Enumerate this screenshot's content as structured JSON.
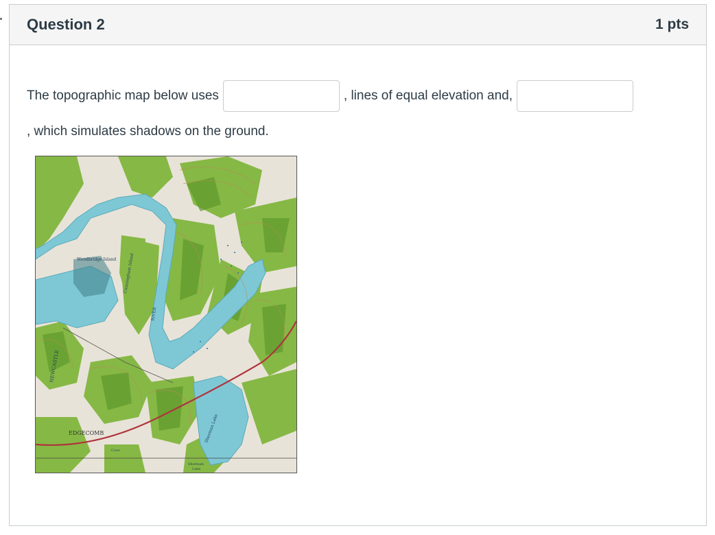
{
  "question": {
    "title": "Question 2",
    "points": "1 pts"
  },
  "prompt": {
    "part1": "The topographic map below uses",
    "part2": ", lines of equal elevation and,",
    "part3": ", which simulates shadows on the ground."
  },
  "blanks": {
    "first_value": "",
    "second_value": ""
  },
  "map": {
    "labels": {
      "woodbridge": "Woodbridge Island",
      "cunningham": "Cunningham Island",
      "river": "RIVER",
      "newcastle": "NEWCASTLE",
      "edgecomb": "EDGECOMB",
      "sherman_lake": "Sherman Lake",
      "sherman": "Sherman",
      "lake": "Lake",
      "cove": "Cove"
    },
    "colors": {
      "water": "#7ec8d6",
      "forest": "#7fb23f",
      "land": "#e7e2d7",
      "road": "#b0343c"
    }
  }
}
